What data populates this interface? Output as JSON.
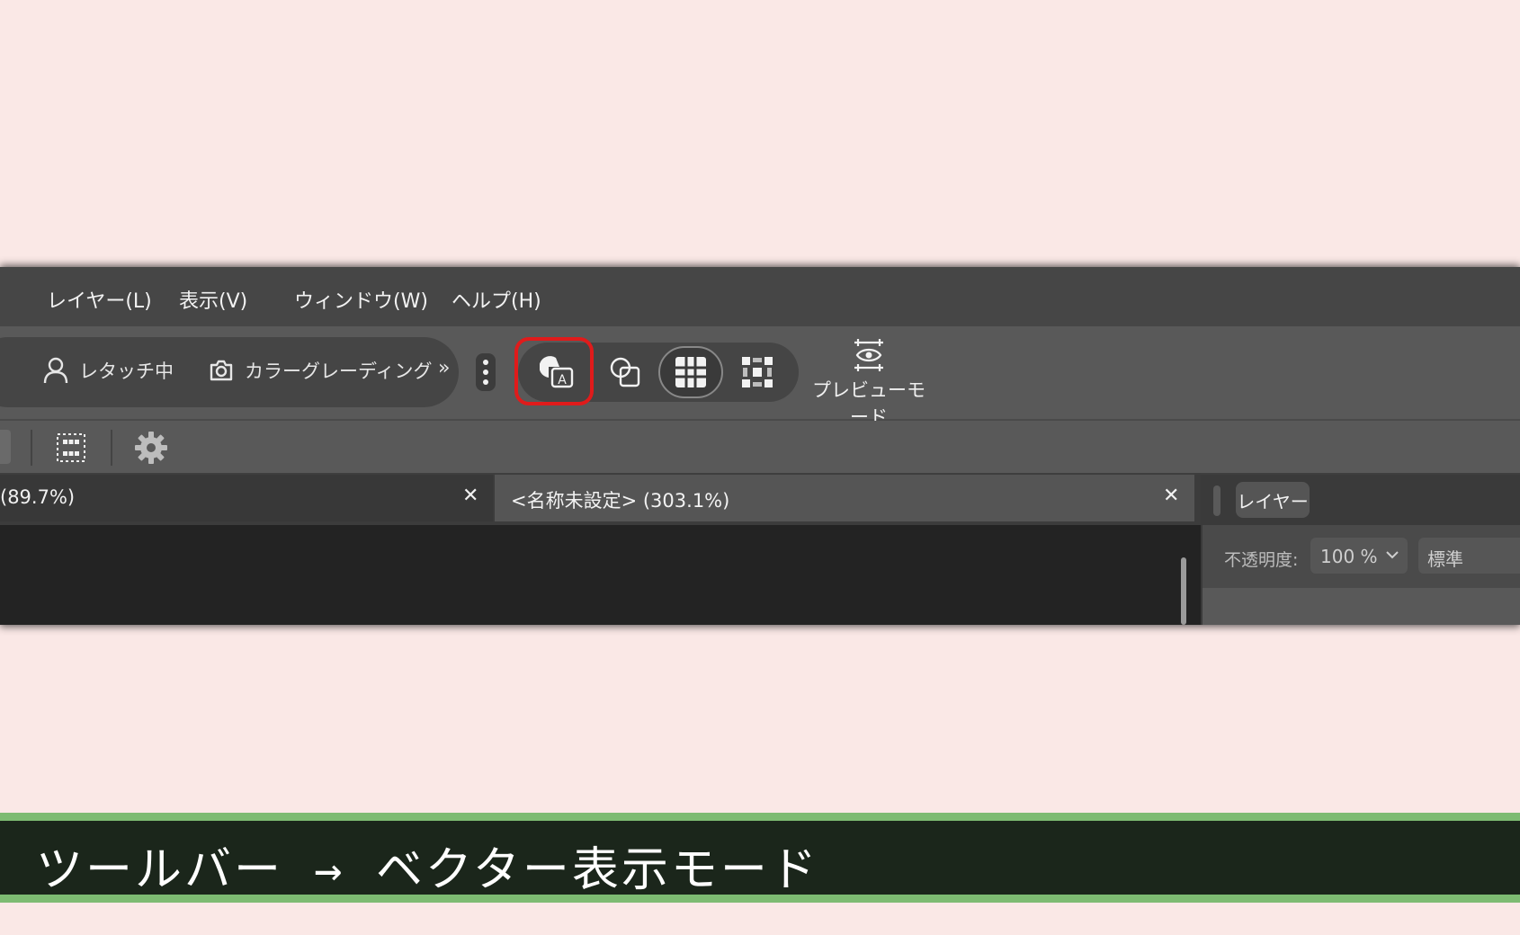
{
  "menu": {
    "items": [
      "レイヤー(L)",
      "表示(V)",
      "ウィンドウ(W)",
      "ヘルプ(H)"
    ]
  },
  "toolbar": {
    "workspaces": [
      {
        "label": "レタッチ中",
        "icon": "person-icon"
      },
      {
        "label": "カラーグレーディング",
        "icon": "camera-icon"
      }
    ],
    "overflow_icon": "double-chevron-right-icon",
    "more_icon": "kebab-menu-icon",
    "view_modes": [
      {
        "icon": "vector-view-mode-icon",
        "highlighted": true
      },
      {
        "icon": "overlapping-shapes-icon"
      },
      {
        "icon": "pixel-grid-icon",
        "active": true
      },
      {
        "icon": "pixel-outline-icon"
      }
    ],
    "preview_mode_label": "プレビューモード",
    "highlight_color": "#e01b1b"
  },
  "toolbar2": {
    "icons": [
      "dotted-grid-selection-icon",
      "gear-icon"
    ]
  },
  "tabs": [
    {
      "title": "(89.7%)",
      "close": "✕"
    },
    {
      "title": "<名称未設定> (303.1%)",
      "close": "✕"
    }
  ],
  "layers_panel": {
    "tab_label": "レイヤー",
    "opacity_label": "不透明度:",
    "opacity_value": "100 %",
    "blend_mode": "標準"
  },
  "caption": {
    "text": "ツールバー → ベクター表示モード",
    "border_color": "#7dbb72",
    "background": "#1b261b"
  }
}
